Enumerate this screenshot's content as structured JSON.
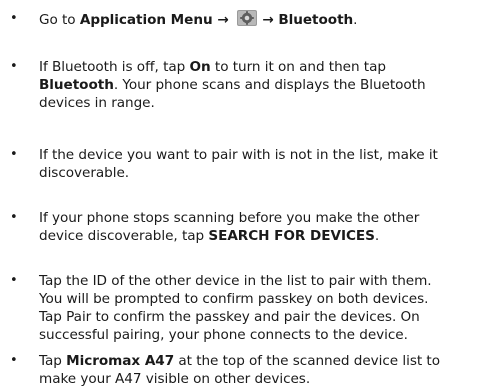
{
  "steps": [
    {
      "lines": [
        [
          {
            "t": "Go to "
          },
          {
            "t": "Application Menu → ",
            "b": true
          },
          {
            "icon": "settings-gear-icon"
          },
          {
            "t": "→ Bluetooth",
            "b": true
          },
          {
            "t": "."
          }
        ]
      ]
    },
    {
      "lines": [
        [
          {
            "t": "If Bluetooth is off, tap "
          },
          {
            "t": "On",
            "b": true
          },
          {
            "t": " to turn it on and then tap"
          }
        ],
        [
          {
            "t": "Bluetooth",
            "b": true
          },
          {
            "t": ". Your phone scans and displays the Bluetooth"
          }
        ],
        [
          {
            "t": "devices in range."
          }
        ]
      ]
    },
    {
      "lines": [
        [
          {
            "t": "If the device you want to pair with is not in the list, make it"
          }
        ],
        [
          {
            "t": "discoverable."
          }
        ]
      ]
    },
    {
      "lines": [
        [
          {
            "t": "If your phone stops scanning before you make the other"
          }
        ],
        [
          {
            "t": "device discoverable, tap "
          },
          {
            "t": "SEARCH FOR DEVICES",
            "b": true
          },
          {
            "t": "."
          }
        ]
      ]
    },
    {
      "lines": [
        [
          {
            "t": "Tap the ID of the other device in the list to pair with them."
          }
        ],
        [
          {
            "t": "You will be prompted to confirm passkey on both devices."
          }
        ],
        [
          {
            "t": "Tap Pair to confirm the passkey and pair the devices. On"
          }
        ],
        [
          {
            "t": "successful pairing, your phone connects to the device."
          }
        ]
      ]
    },
    {
      "lines": [
        [
          {
            "t": "Tap "
          },
          {
            "t": "Micromax A47",
            "b": true
          },
          {
            "t": " at the top of the scanned device list to"
          }
        ],
        [
          {
            "t": "make your A47 visible on other devices."
          }
        ]
      ]
    }
  ]
}
